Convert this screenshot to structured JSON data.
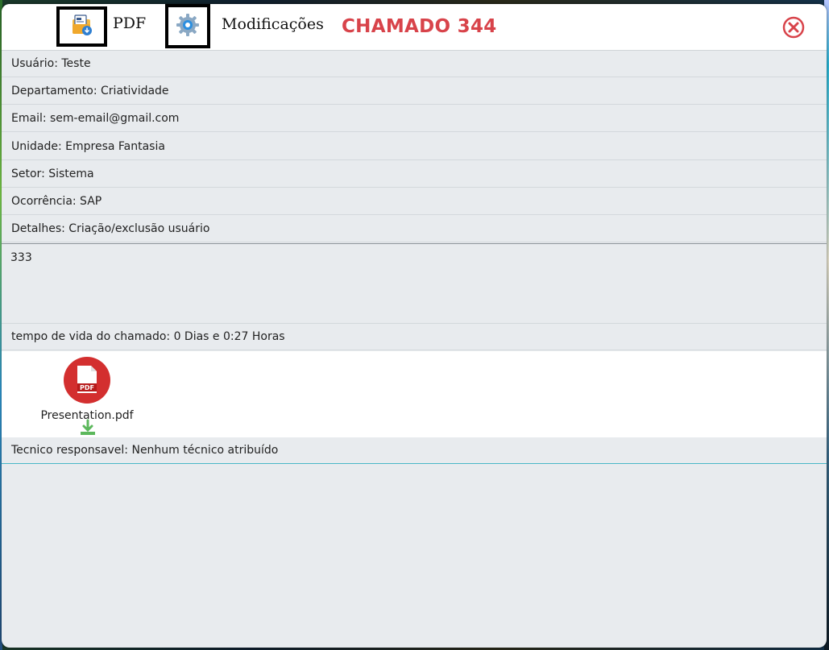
{
  "header": {
    "pdf_label": "PDF",
    "modifications_label": "Modificações",
    "title": "CHAMADO 344",
    "title_color": "#d8434a"
  },
  "fields": {
    "usuario": "Usuário: Teste",
    "departamento": "Departamento: Criatividade",
    "email": "Email: sem-email@gmail.com",
    "unidade": "Unidade: Empresa Fantasia",
    "setor": "Setor: Sistema",
    "ocorrencia": "Ocorrência: SAP",
    "detalhes": "Detalhes: Criação/exclusão usuário"
  },
  "description": "333",
  "lifetime": "tempo de vida do chamado: 0 Dias e 0:27 Horas",
  "attachments": [
    {
      "name": "Presentation.pdf",
      "icon": "pdf-file-icon",
      "badge": "PDF"
    }
  ],
  "technician": "Tecnico responsavel: Nenhum técnico atribuído",
  "icons": {
    "pdf_export": "folder-pdf-icon",
    "modifications": "gear-icon",
    "close": "close-icon",
    "download": "download-icon"
  },
  "colors": {
    "close": "#d8434a",
    "pdf_badge": "#d32f2f",
    "download": "#5cb85c"
  }
}
